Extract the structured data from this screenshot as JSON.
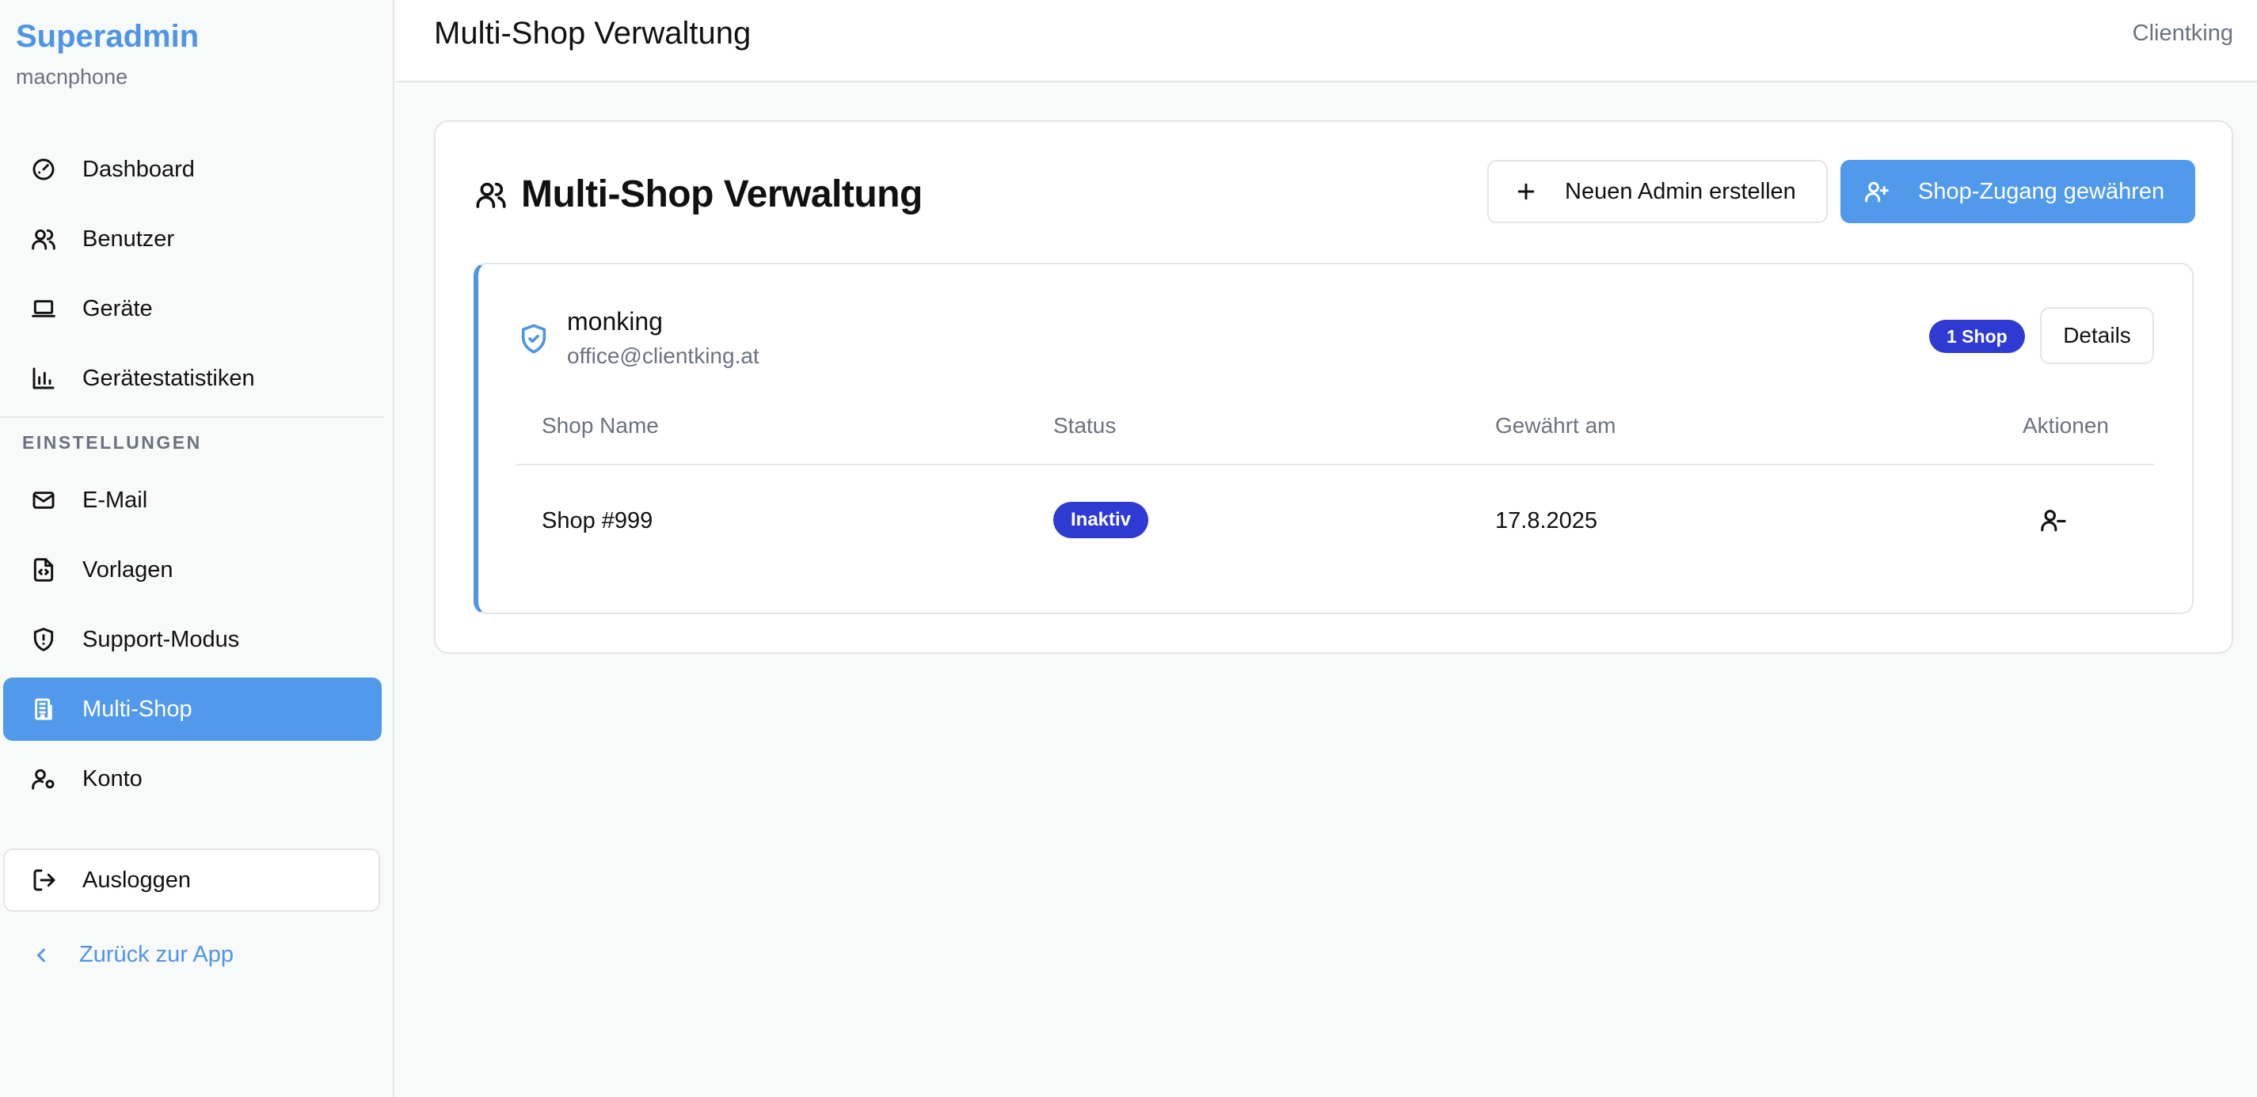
{
  "sidebar": {
    "brand": "Superadmin",
    "tenant": "macnphone",
    "items": [
      {
        "label": "Dashboard",
        "icon": "gauge-icon"
      },
      {
        "label": "Benutzer",
        "icon": "users-icon"
      },
      {
        "label": "Geräte",
        "icon": "laptop-icon"
      },
      {
        "label": "Gerätestatistiken",
        "icon": "bar-chart-icon"
      }
    ],
    "section_label": "EINSTELLUNGEN",
    "settings_items": [
      {
        "label": "E-Mail",
        "icon": "mail-icon"
      },
      {
        "label": "Vorlagen",
        "icon": "file-code-icon"
      },
      {
        "label": "Support-Modus",
        "icon": "shield-alert-icon"
      },
      {
        "label": "Multi-Shop",
        "icon": "building-icon",
        "active": true
      },
      {
        "label": "Konto",
        "icon": "user-cog-icon"
      }
    ],
    "logout_label": "Ausloggen",
    "back_label": "Zurück zur App"
  },
  "topbar": {
    "title": "Multi-Shop Verwaltung",
    "user": "Clientking"
  },
  "main": {
    "title": "Multi-Shop Verwaltung",
    "new_admin_label": "Neuen Admin erstellen",
    "grant_access_label": "Shop-Zugang gewähren",
    "admin": {
      "name": "monking",
      "email": "office@clientking.at",
      "shop_count_badge": "1 Shop",
      "details_label": "Details",
      "columns": [
        "Shop Name",
        "Status",
        "Gewährt am",
        "Aktionen"
      ],
      "rows": [
        {
          "shop_name": "Shop #999",
          "status": "Inaktiv",
          "granted_on": "17.8.2025"
        }
      ]
    }
  },
  "colors": {
    "accent": "#519aeb",
    "badge": "#2e3ad2"
  }
}
